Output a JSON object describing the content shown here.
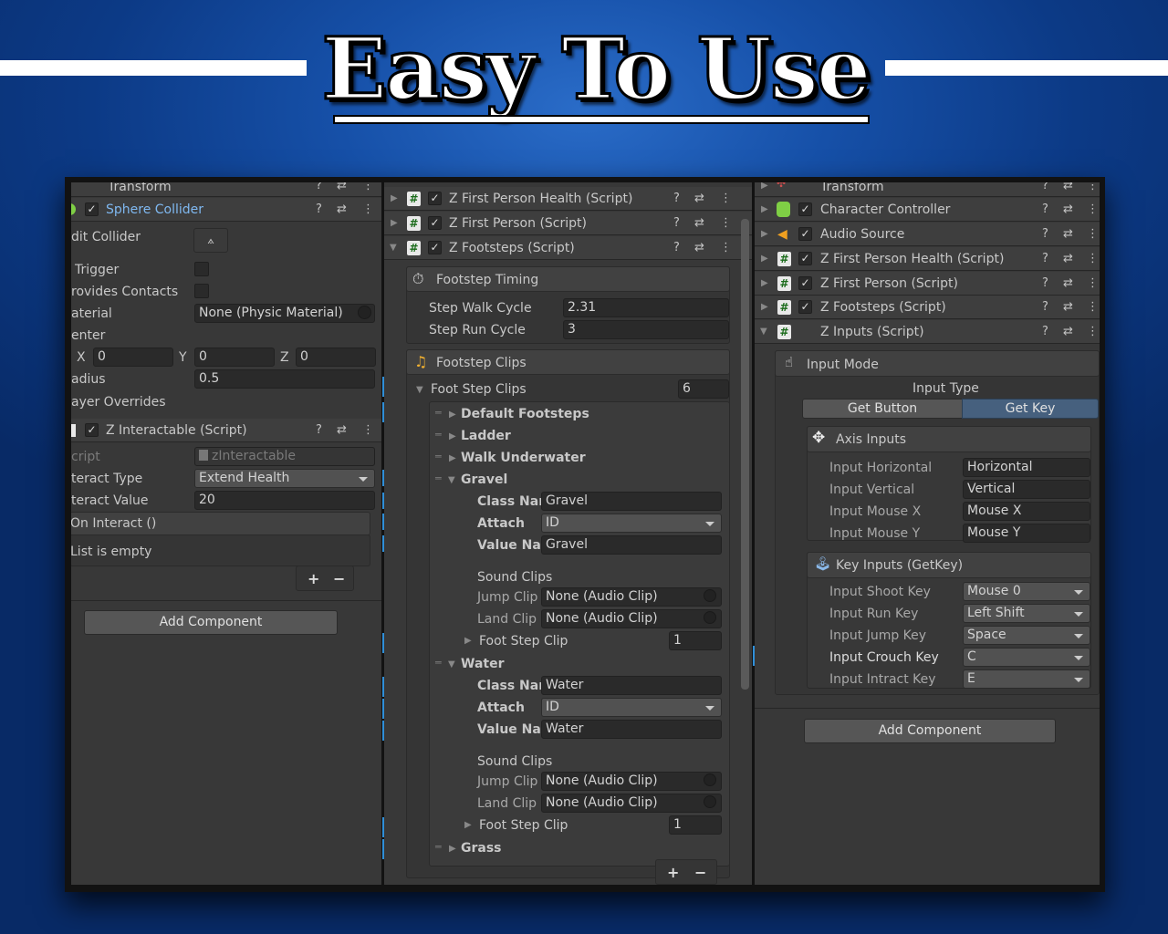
{
  "banner": {
    "title": "Easy To Use"
  },
  "left": {
    "transform": "Transform",
    "sphere": "Sphere Collider",
    "edit_collider": "dit Collider",
    "trigger": "Trigger",
    "provides_contacts": "rovides Contacts",
    "material": "aterial",
    "material_value": "None (Physic Material)",
    "center": "enter",
    "x_label": "X",
    "x_value": "0",
    "y_label": "Y",
    "y_value": "0",
    "z_label": "Z",
    "z_value": "0",
    "radius": "adius",
    "radius_value": "0.5",
    "layer_overrides": "ayer Overrides",
    "interactable": "Z Interactable (Script)",
    "script": "cript",
    "script_value": "zInteractable",
    "interact_type": "teract Type",
    "interact_type_value": "Extend Health",
    "interact_value": "teract Value",
    "interact_value_value": "20",
    "on_interact": "On Interact ()",
    "list_empty": "List is empty",
    "plus": "+",
    "minus": "−",
    "add_component": "Add Component"
  },
  "middle": {
    "h1": "Z First Person Health (Script)",
    "h2": "Z First Person (Script)",
    "h3": "Z Footsteps (Script)",
    "timing_title": "Footstep Timing",
    "step_walk": "Step Walk Cycle",
    "step_walk_value": "2.31",
    "step_run": "Step Run Cycle",
    "step_run_value": "3",
    "clips_title": "Footstep Clips",
    "foot_step_clips": "Foot Step Clips",
    "foot_step_clips_count": "6",
    "default_footsteps": "Default Footsteps",
    "ladder": "Ladder",
    "walk_underwater": "Walk Underwater",
    "gravel": "Gravel",
    "class_nar": "Class Nar",
    "attach": "Attach",
    "value_nar": "Value Nar",
    "gravel_class": "Gravel",
    "id": "ID",
    "gravel_value": "Gravel",
    "sound_clips": "Sound Clips",
    "jump_clip": "Jump Clip",
    "land_clip": "Land Clip",
    "none_audio": "None (Audio Clip)",
    "foot_step_clip": "Foot Step Clip",
    "foot_step_clip_value": "1",
    "water": "Water",
    "water_class": "Water",
    "water_value": "Water",
    "grass": "Grass",
    "plus": "+",
    "minus": "−"
  },
  "right": {
    "transform": "Transform",
    "character_controller": "Character Controller",
    "audio_source": "Audio Source",
    "h_health": "Z First Person Health (Script)",
    "h_fp": "Z First Person (Script)",
    "h_footsteps": "Z Footsteps (Script)",
    "h_inputs": "Z Inputs (Script)",
    "input_mode": "Input Mode",
    "input_type": "Input Type",
    "get_button": "Get Button",
    "get_key": "Get Key",
    "axis_inputs": "Axis Inputs",
    "input_horizontal": "Input Horizontal",
    "horizontal": "Horizontal",
    "input_vertical": "Input Vertical",
    "vertical": "Vertical",
    "input_mouse_x": "Input Mouse X",
    "mouse_x": "Mouse X",
    "input_mouse_y": "Input Mouse Y",
    "mouse_y": "Mouse Y",
    "key_inputs": "Key Inputs (GetKey)",
    "shoot_key": "Input Shoot Key",
    "shoot_val": "Mouse 0",
    "run_key": "Input Run Key",
    "run_val": "Left Shift",
    "jump_key": "Input Jump Key",
    "jump_val": "Space",
    "crouch_key": "Input Crouch Key",
    "crouch_val": "C",
    "intract_key": "Input Intract Key",
    "intract_val": "E",
    "add_component": "Add Component"
  },
  "glyphs": {
    "check": "✓",
    "q": "?",
    "sl": "⇄",
    "dots": "⋮",
    "hash": "#",
    "right": "▶",
    "down": "▼",
    "handle": "═"
  }
}
